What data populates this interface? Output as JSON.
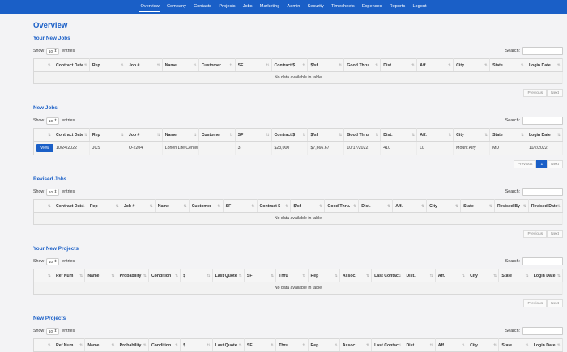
{
  "nav": [
    "Overview",
    "Company",
    "Contacts",
    "Projects",
    "Jobs",
    "Marketing",
    "Admin",
    "Security",
    "Timesheets",
    "Expenses",
    "Reports",
    "Logout"
  ],
  "page_title": "Overview",
  "common": {
    "show": "Show",
    "entries": "entries",
    "page_len": "10",
    "search": "Search:",
    "empty": "No data available in table",
    "previous": "Previous",
    "next": "Next",
    "page1": "1",
    "view": "View"
  },
  "your_new_jobs": {
    "title": "Your New Jobs",
    "columns": [
      "",
      "Contract Date",
      "Rep",
      "Job #",
      "Name",
      "Customer",
      "SF",
      "Contract $",
      "$/sf",
      "Good Thru.",
      "Dist.",
      "Aff.",
      "City",
      "State",
      "Login Date"
    ]
  },
  "new_jobs": {
    "title": "New Jobs",
    "columns": [
      "",
      "Contract Date",
      "Rep",
      "Job #",
      "Name",
      "Customer",
      "SF",
      "Contract $",
      "$/sf",
      "Good Thru.",
      "Dist.",
      "Aff.",
      "City",
      "State",
      "Login Date"
    ],
    "rows": [
      [
        "",
        "10/24/2022",
        "JCS",
        "O-2204",
        "Lorien Life Center Addition",
        "",
        "3",
        "$23,000",
        "$7,666.67",
        "10/17/2022",
        "410",
        "LL",
        "Mount Airy",
        "MD",
        "11/2/2022"
      ]
    ]
  },
  "revised_jobs": {
    "title": "Revised Jobs",
    "columns": [
      "",
      "Contract Date",
      "Rep",
      "Job #",
      "Name",
      "Customer",
      "SF",
      "Contract $",
      "$/sf",
      "Good Thru.",
      "Dist.",
      "Aff.",
      "City",
      "State",
      "Revised By",
      "Revised Date"
    ]
  },
  "your_new_projects": {
    "title": "Your New Projects",
    "columns": [
      "",
      "Ref Num",
      "Name",
      "Probability",
      "Condition",
      "$",
      "Last Quote",
      "SF",
      "Thru",
      "Rep",
      "Assoc.",
      "Last Contact",
      "Dist.",
      "Aff.",
      "City",
      "State",
      "Login Date"
    ]
  },
  "new_projects": {
    "title": "New Projects",
    "columns": [
      "",
      "Ref Num",
      "Name",
      "Probability",
      "Condition",
      "$",
      "Last Quote",
      "SF",
      "Thru",
      "Rep",
      "Assoc.",
      "Last Contact",
      "Dist.",
      "Aff.",
      "City",
      "State",
      "Login Date"
    ]
  }
}
